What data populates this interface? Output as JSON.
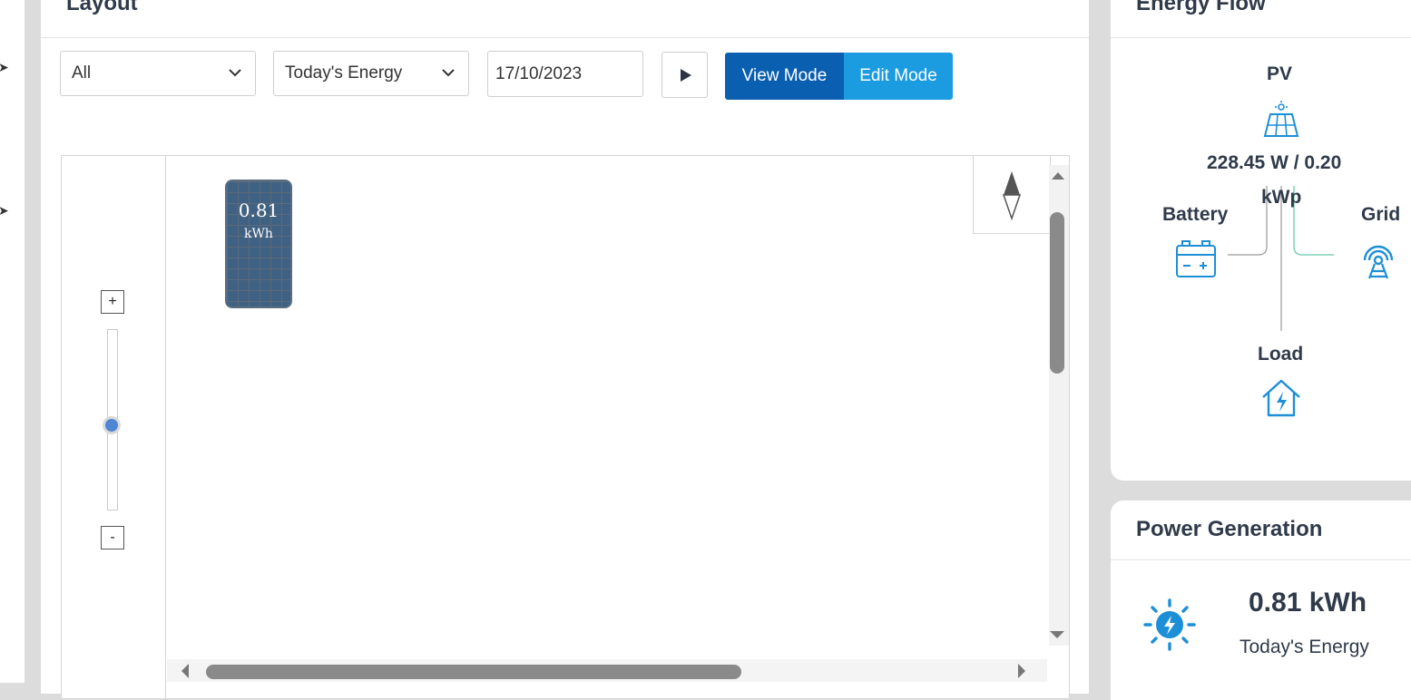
{
  "layout": {
    "title": "Layout",
    "filter_select": {
      "value": "All"
    },
    "metric_select": {
      "value": "Today's Energy"
    },
    "date": "17/10/2023",
    "view_mode_label": "View Mode",
    "edit_mode_label": "Edit Mode",
    "zoom": {
      "plus": "+",
      "minus": "-",
      "level": 0.47
    },
    "panel": {
      "value": "0.81",
      "unit": "kWh"
    }
  },
  "energy_flow": {
    "title": "Energy Flow",
    "pv_label": "PV",
    "pv_value": "228.45 W / 0.20",
    "pv_unit": "kWp",
    "battery_label": "Battery",
    "grid_label": "Grid",
    "load_label": "Load"
  },
  "power_generation": {
    "title": "Power Generation",
    "value": "0.81 kWh",
    "label": "Today's Energy"
  },
  "colors": {
    "primary_dark": "#0a5fb0",
    "primary_light": "#1b9be0",
    "icon_blue": "#1d8fd6",
    "flow_line_green": "#7fd3b4",
    "text": "#2f3a4a"
  },
  "icons": [
    "chevron-down-icon",
    "play-icon",
    "compass-icon",
    "solar-panel-icon",
    "battery-icon",
    "grid-tower-icon",
    "house-bolt-icon",
    "sun-bolt-icon"
  ]
}
